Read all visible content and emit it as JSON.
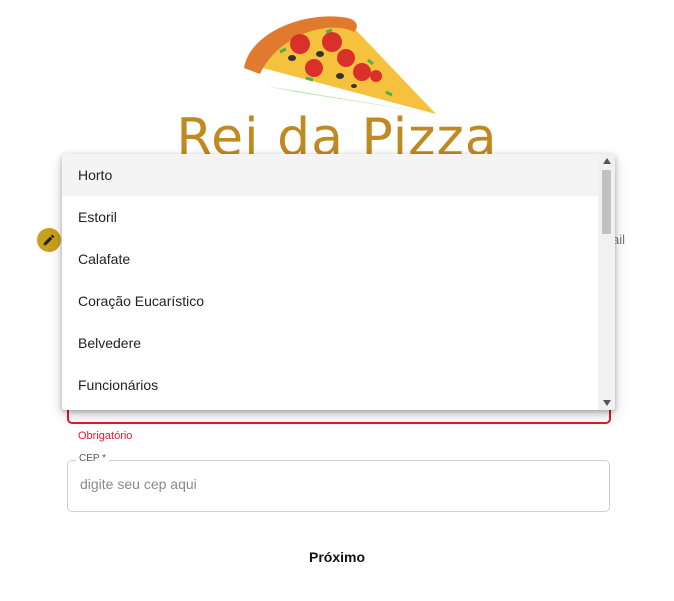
{
  "brand": {
    "title": "Rei da Pizza"
  },
  "form": {
    "behind_text": "ail",
    "error_text": "Obrigatório",
    "cep": {
      "label": "CEP *",
      "placeholder": "digite seu cep aqui",
      "value": ""
    },
    "next_label": "Próximo"
  },
  "dropdown": {
    "options": [
      {
        "label": "Horto"
      },
      {
        "label": "Estoril"
      },
      {
        "label": "Calafate"
      },
      {
        "label": "Coração Eucarístico"
      },
      {
        "label": "Belvedere"
      },
      {
        "label": "Funcionários"
      }
    ]
  },
  "colors": {
    "brand": "#c08a22",
    "error": "#e0192a",
    "fab": "#c8a01a"
  },
  "icons": {
    "logo": "pizza-slice-icon",
    "edit": "pencil-icon"
  }
}
